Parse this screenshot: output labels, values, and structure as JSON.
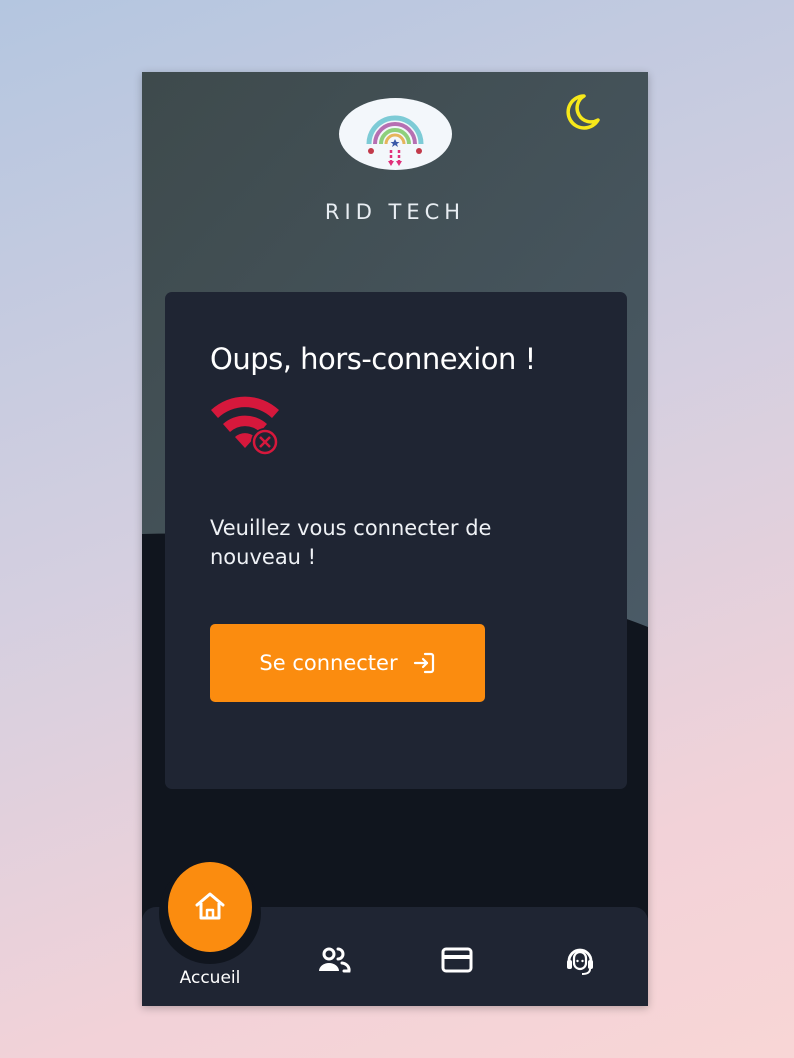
{
  "app": {
    "brand_name": "RID TECH"
  },
  "offline_card": {
    "title": "Oups, hors-connexion !",
    "message": "Veuillez vous connecter de nouveau !",
    "connect_label": "Se connecter"
  },
  "bottom_nav": {
    "active_label": "Accueil",
    "items": [
      {
        "id": "home",
        "icon": "home-icon",
        "label": "Accueil"
      },
      {
        "id": "users",
        "icon": "users-icon"
      },
      {
        "id": "card",
        "icon": "credit-card-icon"
      },
      {
        "id": "support",
        "icon": "support-headset-icon"
      }
    ]
  },
  "colors": {
    "accent": "#fb8c0f",
    "offline_red": "#d6183c",
    "moon": "#f7e81a",
    "card_bg": "#1f2533",
    "page_bg": "#10151e"
  }
}
